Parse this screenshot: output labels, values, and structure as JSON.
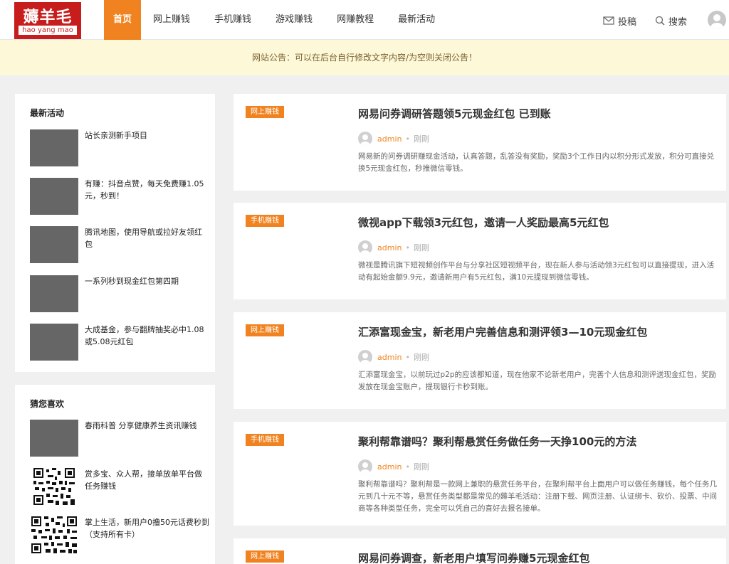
{
  "header": {
    "logo": {
      "text_cn": "薅羊毛",
      "text_pinyin": "hao yang mao"
    },
    "nav": [
      {
        "label": "首页",
        "active": true
      },
      {
        "label": "网上赚钱",
        "active": false
      },
      {
        "label": "手机赚钱",
        "active": false
      },
      {
        "label": "游戏赚钱",
        "active": false
      },
      {
        "label": "网赚教程",
        "active": false
      },
      {
        "label": "最新活动",
        "active": false
      }
    ],
    "contribute_label": "投稿",
    "search_label": "搜索"
  },
  "notice": {
    "text": "网站公告：可以在后台自行修改文字内容/为空则关闭公告！"
  },
  "sidebar": {
    "latest": {
      "title": "最新活动",
      "items": [
        {
          "title": "站长亲测新手项目"
        },
        {
          "title": "有赚：抖音点赞，每天免费赚1.05元，秒到！"
        },
        {
          "title": "腾讯地图，使用导航或拉好友领红包"
        },
        {
          "title": "一系列秒到现金红包第四期"
        },
        {
          "title": "大成基金，参与翻牌抽奖必中1.08或5.08元红包"
        }
      ]
    },
    "guess": {
      "title": "猜您喜欢",
      "items": [
        {
          "title": "春雨科普 分享健康养生资讯赚钱",
          "thumb": "image"
        },
        {
          "title": "赏多宝、众人帮，接单放单平台做任务赚钱",
          "thumb": "qr"
        },
        {
          "title": "掌上生活，新用户0撸50元话费秒到（支持所有卡）",
          "thumb": "qr"
        }
      ]
    }
  },
  "posts": [
    {
      "category": "网上赚钱",
      "title": "网易问券调研答题领5元现金红包 已到账",
      "author": "admin",
      "time": "刚刚",
      "excerpt": "网易新的问券调研赚现金活动，认真答题，乱答没有奖励，奖励3个工作日内以积分形式发放，积分可直接兑换5元现金红包，秒推微信零钱。"
    },
    {
      "category": "手机赚钱",
      "title": "微视app下载领3元红包，邀请一人奖励最高5元红包",
      "author": "admin",
      "time": "刚刚",
      "excerpt": "微视是腾讯旗下短视频创作平台与分享社区短视频平台，现在新人参与活动领3元红包可以直接提现，进入活动有起始金额9.9元，邀请新用户有5元红包，满10元提现到微信零钱。"
    },
    {
      "category": "网上赚钱",
      "title": "汇添富现金宝，新老用户完善信息和测评领3—10元现金红包",
      "author": "admin",
      "time": "刚刚",
      "excerpt": "汇添富现金宝，以前玩过p2p的应该都知道，现在他家不论新老用户，完善个人信息和测评送现金红包，奖励发放在现金宝账户，提现银行卡秒到账。"
    },
    {
      "category": "手机赚钱",
      "title": "聚利帮靠谱吗？聚利帮悬赏任务做任务一天挣100元的方法",
      "author": "admin",
      "time": "刚刚",
      "excerpt": "聚利帮靠谱吗？聚利帮是一款网上兼职的悬赏任务平台，在聚利帮平台上面用户可以做任务赚钱，每个任务几元到几十元不等，悬赏任务类型都是常见的薅羊毛活动：注册下载、网页注册、认证绑卡、砍价、投票、中间商等各种类型任务，完全可以凭自己的喜好去报名接单。"
    },
    {
      "category": "网上赚钱",
      "title": "网易问券调查，新老用户填写问券赚5元现金红包",
      "author": "admin",
      "time": "刚刚",
      "excerpt": ""
    }
  ],
  "colors": {
    "accent": "#f08320",
    "logo_red": "#c81d1d",
    "notice_bg": "#fdf8d8",
    "page_bg": "#f0f0f0"
  }
}
